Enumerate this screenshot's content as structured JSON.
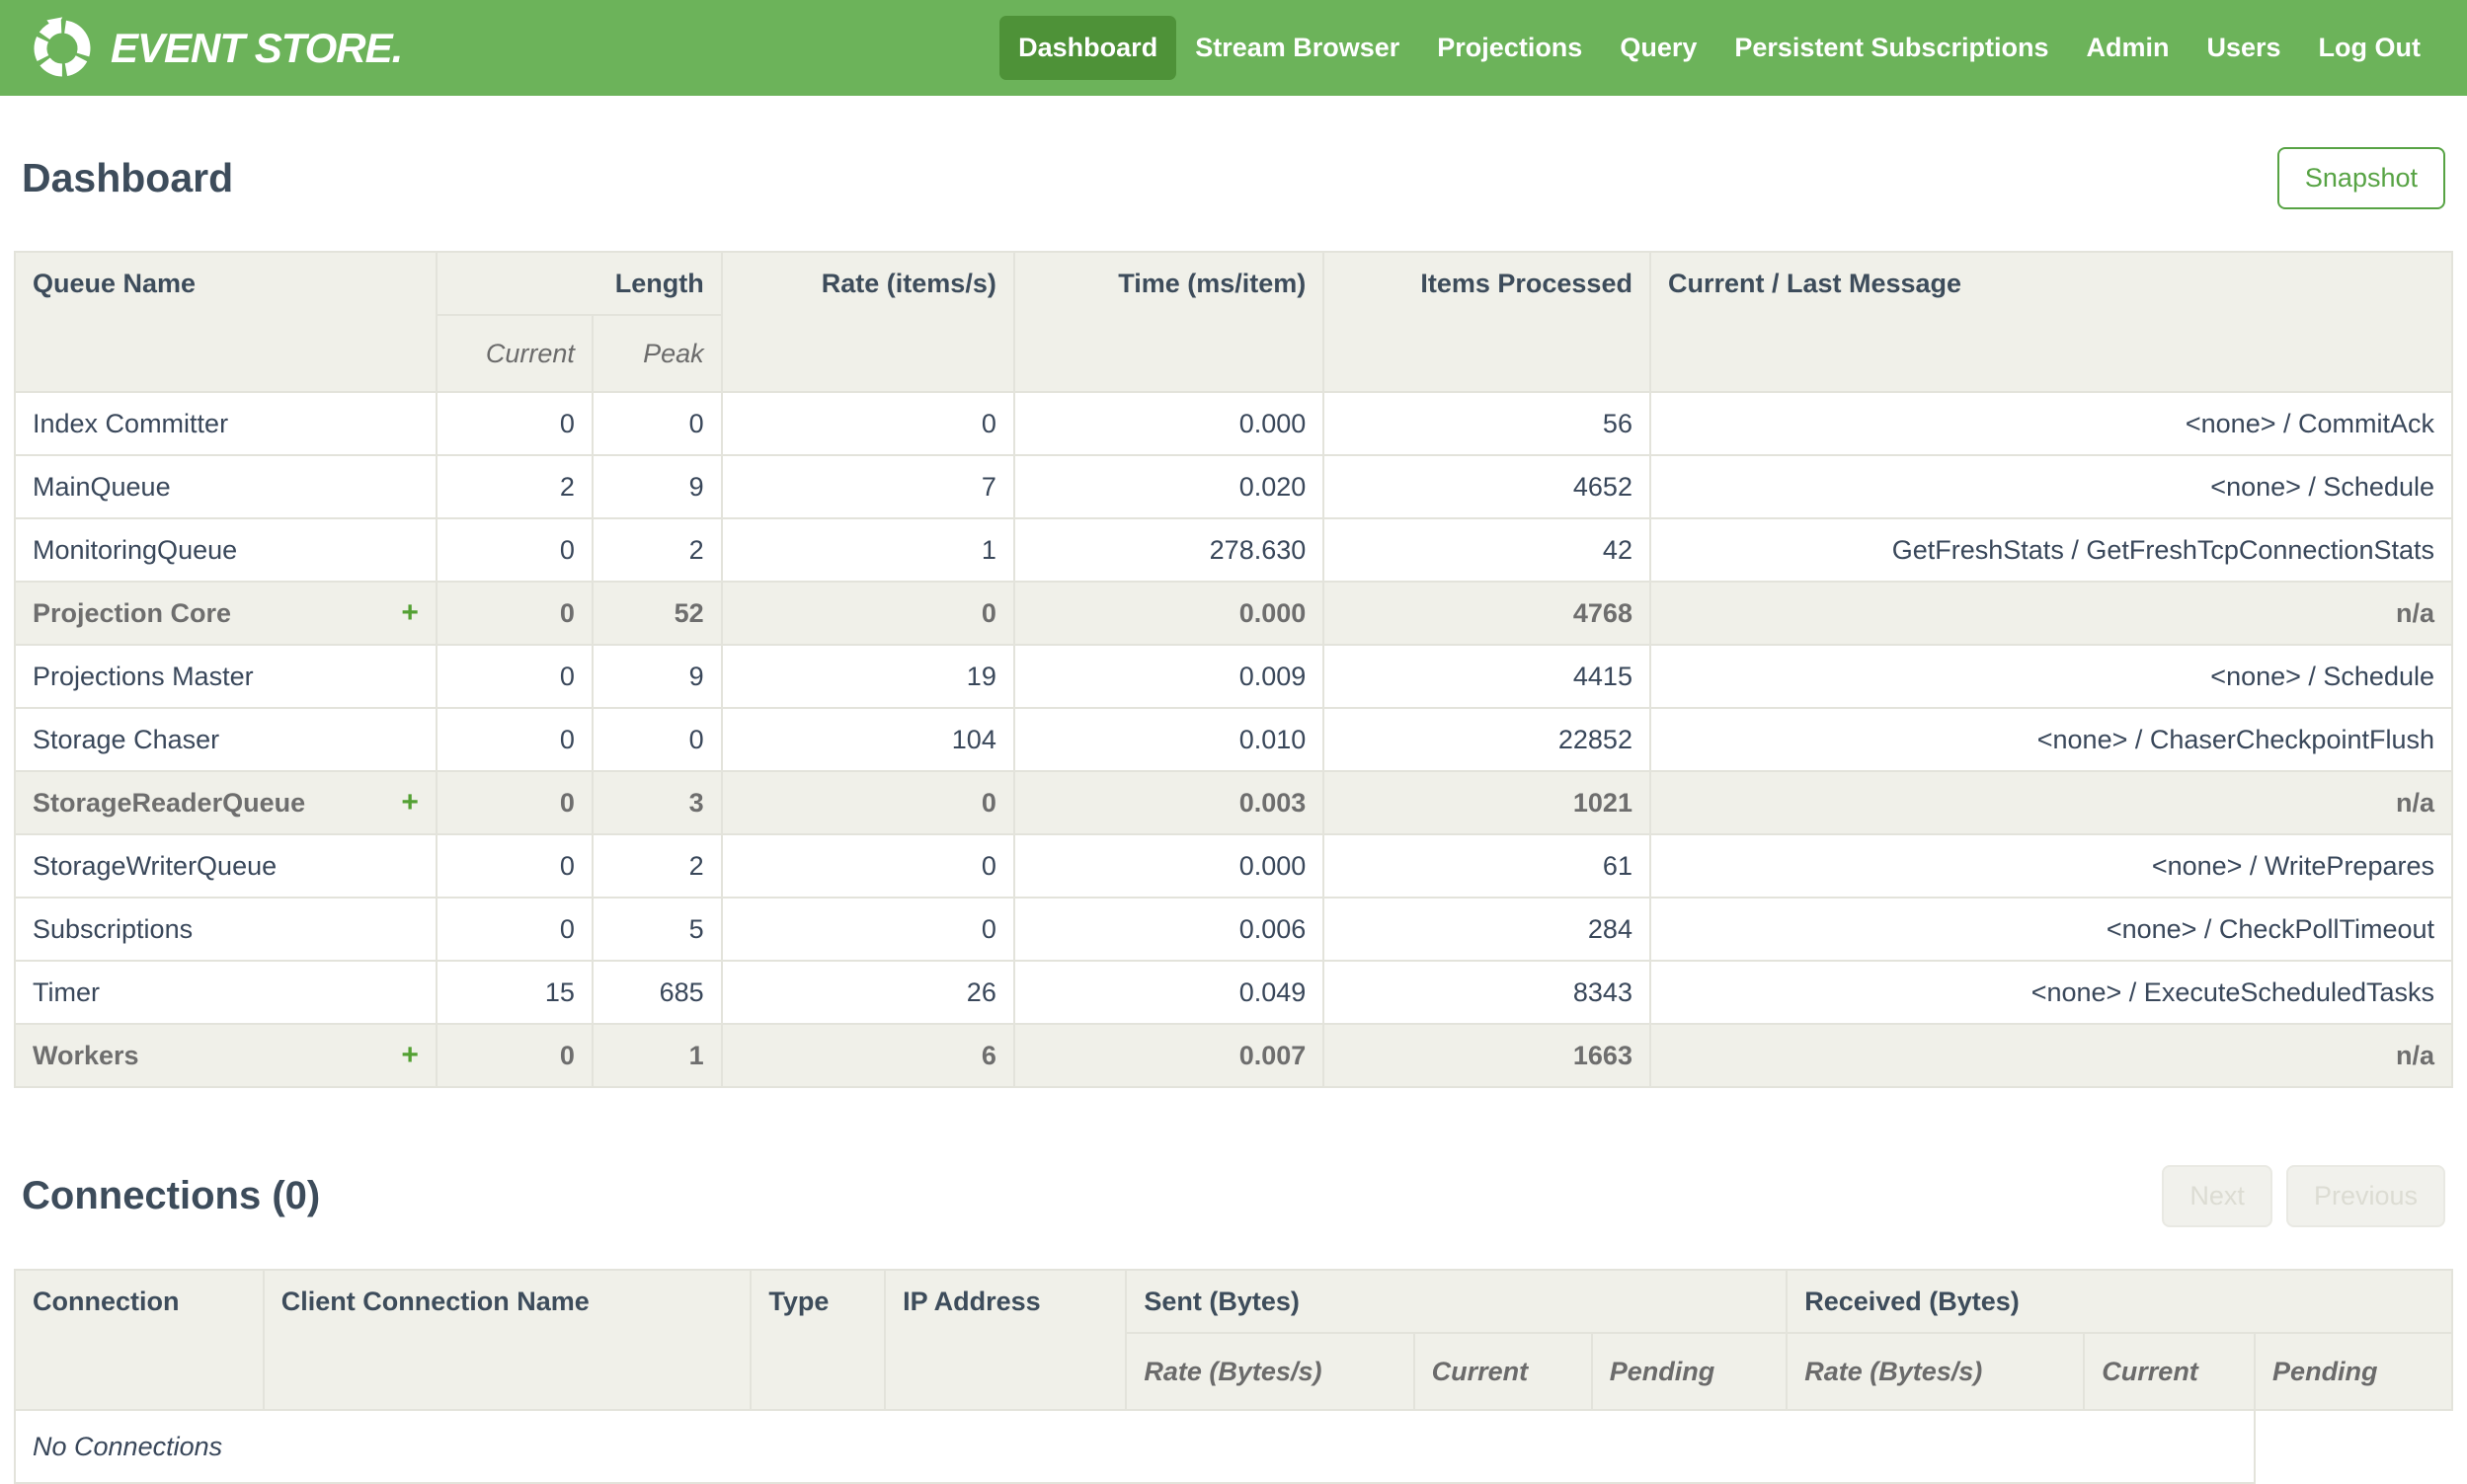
{
  "navbar": {
    "brand": "EVENT STORE.",
    "items": [
      {
        "label": "Dashboard",
        "active": true
      },
      {
        "label": "Stream Browser",
        "active": false
      },
      {
        "label": "Projections",
        "active": false
      },
      {
        "label": "Query",
        "active": false
      },
      {
        "label": "Persistent Subscriptions",
        "active": false
      },
      {
        "label": "Admin",
        "active": false
      },
      {
        "label": "Users",
        "active": false
      },
      {
        "label": "Log Out",
        "active": false
      }
    ]
  },
  "page": {
    "title": "Dashboard",
    "snapshot_button": "Snapshot"
  },
  "queues_table": {
    "headers": {
      "queue_name": "Queue Name",
      "length": "Length",
      "current": "Current",
      "peak": "Peak",
      "rate": "Rate (items/s)",
      "time": "Time (ms/item)",
      "items_processed": "Items Processed",
      "message": "Current / Last Message"
    },
    "expand_icon": "+",
    "rows": [
      {
        "name": "Index Committer",
        "expandable": false,
        "current": "0",
        "peak": "0",
        "rate": "0",
        "time": "0.000",
        "items": "56",
        "message": "<none> / CommitAck"
      },
      {
        "name": "MainQueue",
        "expandable": false,
        "current": "2",
        "peak": "9",
        "rate": "7",
        "time": "0.020",
        "items": "4652",
        "message": "<none> / Schedule"
      },
      {
        "name": "MonitoringQueue",
        "expandable": false,
        "current": "0",
        "peak": "2",
        "rate": "1",
        "time": "278.630",
        "items": "42",
        "message": "GetFreshStats / GetFreshTcpConnectionStats"
      },
      {
        "name": "Projection Core",
        "expandable": true,
        "current": "0",
        "peak": "52",
        "rate": "0",
        "time": "0.000",
        "items": "4768",
        "message": "n/a"
      },
      {
        "name": "Projections Master",
        "expandable": false,
        "current": "0",
        "peak": "9",
        "rate": "19",
        "time": "0.009",
        "items": "4415",
        "message": "<none> / Schedule"
      },
      {
        "name": "Storage Chaser",
        "expandable": false,
        "current": "0",
        "peak": "0",
        "rate": "104",
        "time": "0.010",
        "items": "22852",
        "message": "<none> / ChaserCheckpointFlush"
      },
      {
        "name": "StorageReaderQueue",
        "expandable": true,
        "current": "0",
        "peak": "3",
        "rate": "0",
        "time": "0.003",
        "items": "1021",
        "message": "n/a"
      },
      {
        "name": "StorageWriterQueue",
        "expandable": false,
        "current": "0",
        "peak": "2",
        "rate": "0",
        "time": "0.000",
        "items": "61",
        "message": "<none> / WritePrepares"
      },
      {
        "name": "Subscriptions",
        "expandable": false,
        "current": "0",
        "peak": "5",
        "rate": "0",
        "time": "0.006",
        "items": "284",
        "message": "<none> / CheckPollTimeout"
      },
      {
        "name": "Timer",
        "expandable": false,
        "current": "15",
        "peak": "685",
        "rate": "26",
        "time": "0.049",
        "items": "8343",
        "message": "<none> / ExecuteScheduledTasks"
      },
      {
        "name": "Workers",
        "expandable": true,
        "current": "0",
        "peak": "1",
        "rate": "6",
        "time": "0.007",
        "items": "1663",
        "message": "n/a"
      }
    ]
  },
  "connections": {
    "title": "Connections (0)",
    "next_button": "Next",
    "previous_button": "Previous",
    "headers": {
      "connection": "Connection",
      "client_connection_name": "Client Connection Name",
      "type": "Type",
      "ip_address": "IP Address",
      "sent": "Sent (Bytes)",
      "received": "Received (Bytes)",
      "rate": "Rate (Bytes/s)",
      "current": "Current",
      "pending": "Pending"
    },
    "empty_message": "No Connections"
  },
  "colors": {
    "navbar_green": "#6cb35a",
    "active_nav_green": "#4e9238",
    "accent_green": "#57a344",
    "plus_green": "#53a033",
    "header_bg": "#f0f0e9",
    "border": "#e3e3db",
    "text_dark": "#39475a",
    "heading_dark": "#3d4c5b",
    "group_text_gray": "#6e6e6e",
    "disabled_text": "#dcdcd3"
  }
}
